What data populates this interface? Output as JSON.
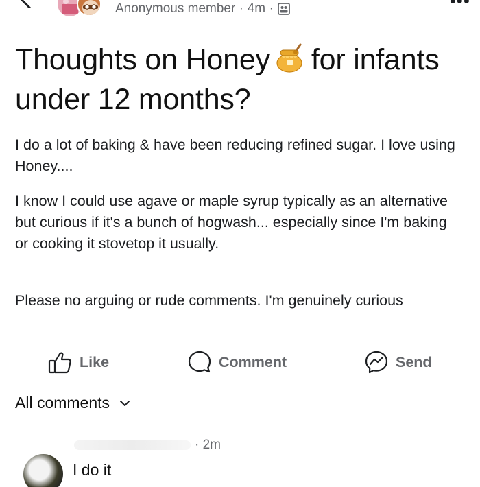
{
  "post": {
    "author": "Anonymous member",
    "time": "4m",
    "separator": "·",
    "title_part1": "Thoughts on Honey",
    "title_part2": "for infants under 12 months?",
    "paragraphs": [
      "I do a lot of baking & have been reducing refined sugar. I love using Honey....",
      "I know I could use agave or maple syrup typically as an alternative but curious if it's a bunch of hogwash... especially since I'm baking or cooking it stovetop it usually.",
      "Please no arguing or rude comments. I'm genuinely curious"
    ]
  },
  "actions": {
    "like": "Like",
    "comment": "Comment",
    "send": "Send"
  },
  "comments_header": {
    "label": "All comments"
  },
  "comment": {
    "time": "· 2m",
    "text": "I do it"
  },
  "colors": {
    "text": "#1c1e21",
    "muted": "#65676b",
    "honey": "#e8a72a"
  },
  "icons": [
    "back-chevron-icon",
    "group-icon",
    "honey-pot-icon",
    "like-icon",
    "comment-icon",
    "send-icon",
    "chevron-down-icon",
    "more-icon"
  ]
}
